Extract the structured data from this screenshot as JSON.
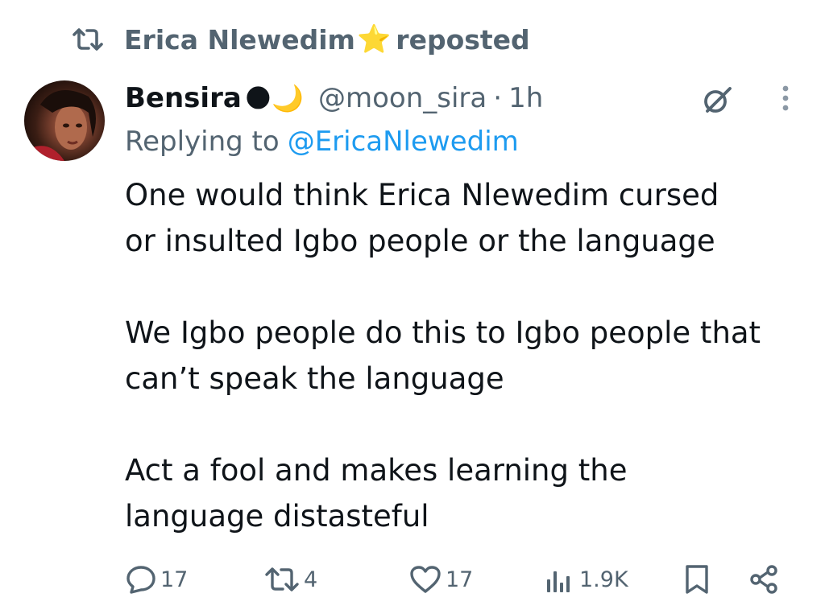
{
  "repost": {
    "user": "Erica Nlewedim",
    "badge": "⭐",
    "label": "reposted"
  },
  "tweet": {
    "author_name": "Bensira",
    "author_emoji": "🌑🌙",
    "handle": "@moon_sira",
    "separator": "·",
    "time": "1h",
    "replying_label": "Replying to",
    "replying_to": "@EricaNlewedim",
    "paragraphs": [
      [
        "One would think Erica Nlewedim cursed",
        "or insulted Igbo people or the language"
      ],
      [
        "We Igbo people do this to Igbo people that",
        "can’t speak the language"
      ],
      [
        "Act a fool and makes learning the",
        "language distasteful"
      ]
    ]
  },
  "actions": {
    "replies": "17",
    "reposts": "4",
    "likes": "17",
    "views": "1.9K"
  },
  "icons": [
    "repost-icon",
    "grok-icon",
    "more-icon",
    "reply-icon",
    "like-icon",
    "views-icon",
    "bookmark-icon",
    "share-icon"
  ],
  "colors": {
    "text": "#0f1419",
    "secondary": "#536471",
    "link": "#1d9bf0"
  }
}
